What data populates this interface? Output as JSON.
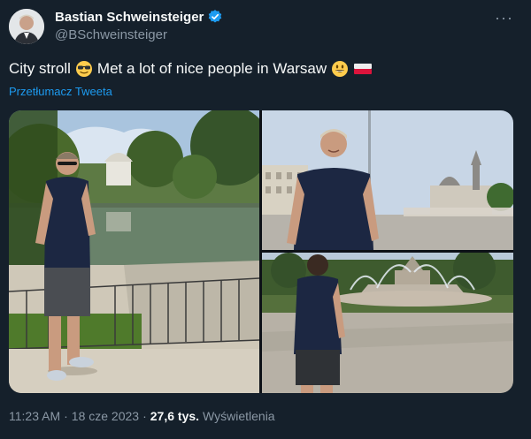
{
  "author": {
    "display_name": "Bastian Schweinsteiger",
    "handle": "@BSchweinsteiger",
    "verified": true
  },
  "tweet": {
    "text_part1": "City stroll",
    "text_part2": "Met a lot of nice people in Warsaw",
    "emojis": [
      "sunglasses-emoji",
      "grinning-emoji",
      "poland-flag-emoji"
    ],
    "translate_label": "Przetłumacz Tweeta"
  },
  "meta": {
    "time": "11:23 AM",
    "separator": "·",
    "date": "18 cze 2023",
    "views_count": "27,6 tys.",
    "views_label": "Wyświetlenia"
  },
  "colors": {
    "background": "#15202b",
    "text": "#f7f9f9",
    "secondary": "#8b98a5",
    "link": "#1d9bf0",
    "verified": "#1d9bf0"
  }
}
